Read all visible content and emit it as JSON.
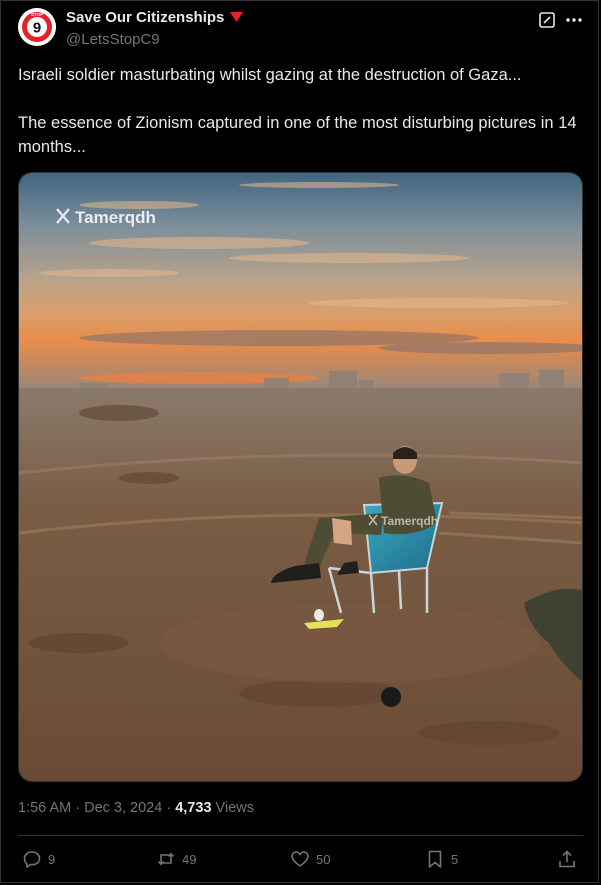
{
  "author": {
    "display_name": "Save Our Citizenships",
    "handle": "@LetsStopC9",
    "avatar_text": "9",
    "avatar_ring_text": "STOP"
  },
  "tweet": {
    "paragraph_1": "Israeli soldier masturbating whilst gazing at the destruction of Gaza...",
    "paragraph_2": "The essence of Zionism captured in one of the most disturbing pictures in 14 months..."
  },
  "media": {
    "watermark": "Tamerqdh",
    "watermark_icon": "x-logo"
  },
  "meta": {
    "time": "1:56 AM",
    "date": "Dec 3, 2024",
    "separator": "·",
    "views_count": "4,733",
    "views_label": "Views"
  },
  "actions": {
    "replies": "9",
    "reposts": "49",
    "likes": "50",
    "bookmarks": "5"
  },
  "colors": {
    "background": "#000000",
    "text_primary": "#e7e9ea",
    "text_secondary": "#71767b",
    "divider": "#2f3336",
    "brand_red": "#e8202a"
  },
  "icons": [
    "grok-icon",
    "more-icon",
    "reply-icon",
    "repost-icon",
    "like-icon",
    "bookmark-icon",
    "share-icon",
    "red-triangle-icon"
  ]
}
